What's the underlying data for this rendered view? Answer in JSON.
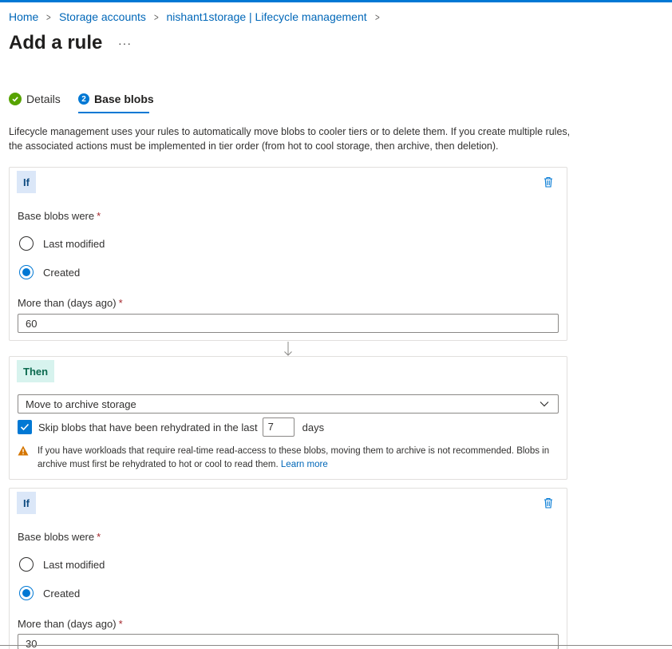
{
  "breadcrumb": {
    "home": "Home",
    "storage_accounts": "Storage accounts",
    "lifecycle": "nishant1storage | Lifecycle management"
  },
  "page": {
    "title": "Add a rule",
    "more": "···"
  },
  "tabs": [
    {
      "label": "Details",
      "state": "completed"
    },
    {
      "label": "Base blobs",
      "step": "2",
      "state": "active"
    }
  ],
  "description": "Lifecycle management uses your rules to automatically move blobs to cooler tiers or to delete them. If you create multiple rules, the associated actions must be implemented in tier order (from hot to cool storage, then archive, then deletion).",
  "rule1": {
    "badge": "If",
    "base_label": "Base blobs were",
    "required": "*",
    "option_last_modified": "Last modified",
    "option_created": "Created",
    "selected": "Created",
    "days_label": "More than (days ago)",
    "days_value": "60"
  },
  "then": {
    "badge": "Then",
    "action": "Move to archive storage",
    "skip_label": "Skip blobs that have been rehydrated in the last",
    "skip_checked": true,
    "skip_days": "7",
    "days_suffix": "days",
    "warning_text": "If you have workloads that require real-time read-access to these blobs, moving them to archive is not recommended. Blobs in archive must first be rehydrated to hot or cool to read them.",
    "learn_more": "Learn more"
  },
  "rule2": {
    "badge": "If",
    "base_label": "Base blobs were",
    "required": "*",
    "option_last_modified": "Last modified",
    "option_created": "Created",
    "selected": "Created",
    "days_label": "More than (days ago)",
    "days_value": "30"
  },
  "colors": {
    "accent": "#0078d4",
    "success": "#57a300",
    "warning": "#d47500",
    "link": "#0067b8"
  },
  "icons": [
    "checkmark-circle-icon",
    "step-number-icon",
    "trash-icon",
    "arrow-down-icon",
    "chevron-down-icon",
    "checkbox-check-icon",
    "warning-icon",
    "chevron-right-icon"
  ]
}
